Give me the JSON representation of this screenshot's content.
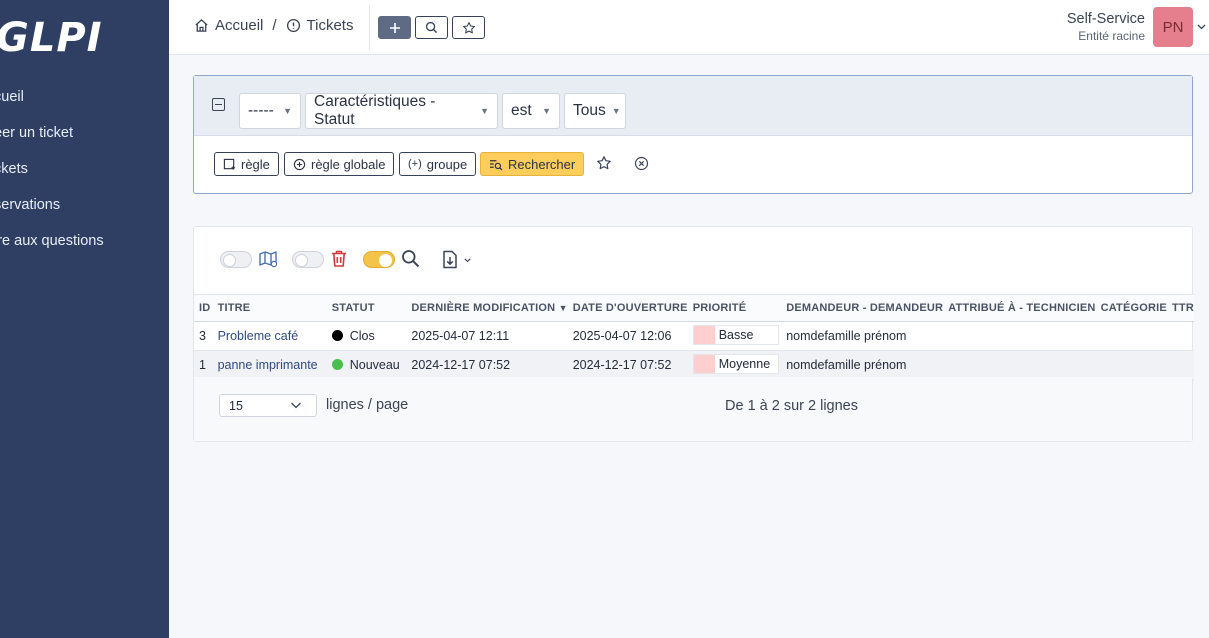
{
  "app": {
    "logo_text": "GLPI"
  },
  "sidebar": {
    "items": [
      {
        "label": "cueil"
      },
      {
        "label": "éer un ticket"
      },
      {
        "label": "ckets"
      },
      {
        "label": "servations"
      },
      {
        "label": "ire aux questions"
      }
    ]
  },
  "header": {
    "breadcrumb": [
      {
        "label": "Accueil"
      },
      {
        "label": "Tickets"
      }
    ],
    "separator": "/",
    "profile_name": "Self-Service",
    "entity": "Entité racine",
    "avatar_initials": "PN"
  },
  "search": {
    "field_prefix": "-----",
    "field": "Caractéristiques - Statut",
    "operator": "est",
    "value": "Tous",
    "rule_label": "règle",
    "global_rule_label": "règle globale",
    "group_label": "groupe",
    "search_label": "Rechercher"
  },
  "table": {
    "columns": [
      "ID",
      "TITRE",
      "STATUT",
      "DERNIÈRE MODIFICATION",
      "DATE D'OUVERTURE",
      "PRIORITÉ",
      "DEMANDEUR - DEMANDEUR",
      "ATTRIBUÉ À - TECHNICIEN",
      "CATÉGORIE",
      "TTR"
    ],
    "sort_indicator": "▼",
    "rows": [
      {
        "id": "3",
        "title": "Probleme café",
        "status": "Clos",
        "status_color": "#000000",
        "modified": "2025-04-07 12:11",
        "opened": "2025-04-07 12:06",
        "priority": "Basse",
        "priority_color": "#ffcfcf",
        "requester": "nomdefamille prénom",
        "technician": "",
        "category": "",
        "ttr": ""
      },
      {
        "id": "1",
        "title": "panne imprimante",
        "status": "Nouveau",
        "status_color": "#49bf4d",
        "modified": "2024-12-17 07:52",
        "opened": "2024-12-17 07:52",
        "priority": "Moyenne",
        "priority_color": "#ffcfcf",
        "requester": "nomdefamille prénom",
        "technician": "",
        "category": "",
        "ttr": ""
      }
    ]
  },
  "pager": {
    "per_page": "15",
    "per_page_label": "lignes / page",
    "info": "De 1 à 2 sur 2 lignes"
  }
}
